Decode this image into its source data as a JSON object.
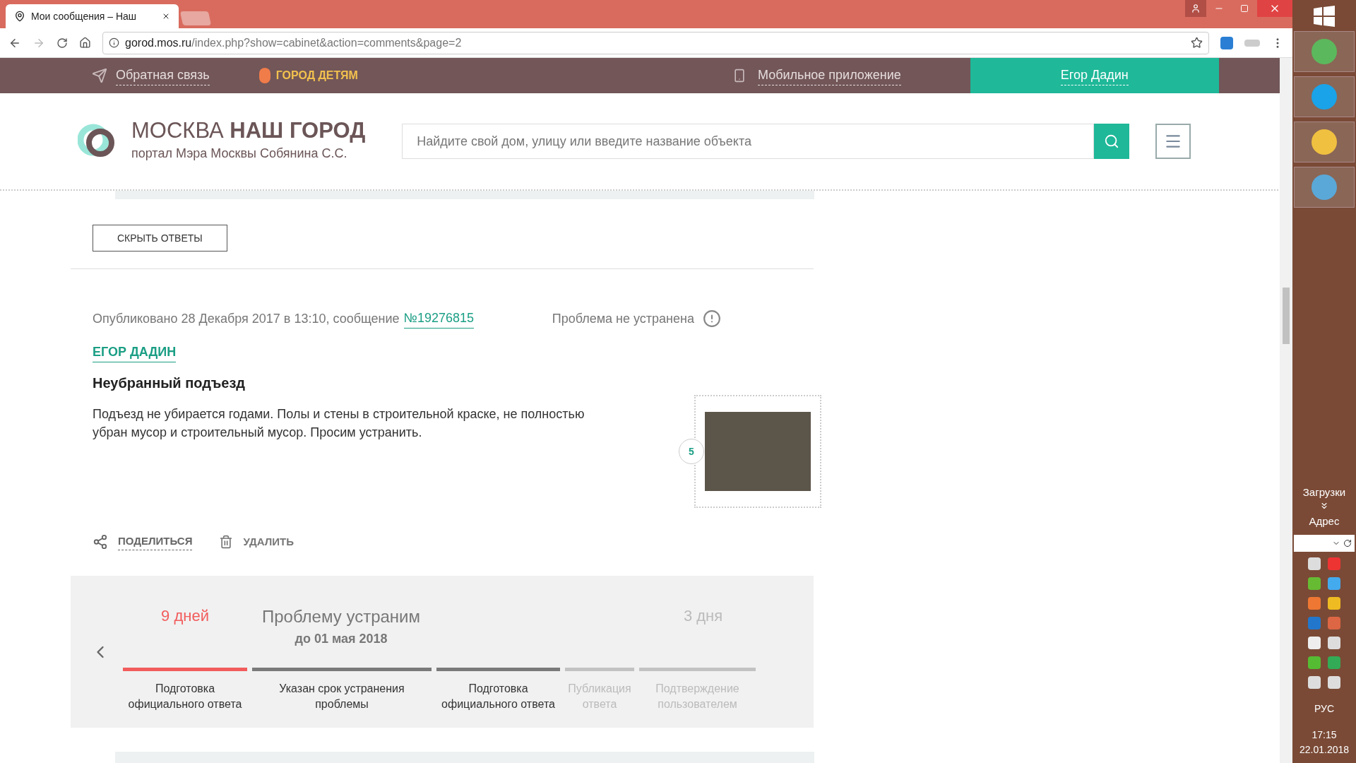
{
  "browser": {
    "tabs": [
      {
        "title": "Мои сообщения – Наш",
        "selected": true
      }
    ],
    "address": {
      "host": "gorod.mos.ru",
      "path": "/index.php?show=cabinet&action=comments&page=2"
    }
  },
  "site_nav": {
    "feedback": "Обратная связь",
    "kids": "ГОРОД ДЕТЯМ",
    "mobile": "Мобильное приложение",
    "user": "Егор Дадин"
  },
  "header": {
    "logo_light": "МОСКВА",
    "logo_bold": "НАШ ГОРОД",
    "logo_subtitle": "портал Мэра Москвы Собянина С.С.",
    "search": {
      "placeholder": "Найдите свой дом, улицу или введите название объекта"
    }
  },
  "hide_answers_button": "СКРЫТЬ ОТВЕТЫ",
  "comment": {
    "published": "Опубликовано 28 Декабря 2017 в 13:10, сообщение",
    "number": "№19276815",
    "status": "Проблема не устранена",
    "author": "ЕГОР ДАДИН",
    "title": "Неубранный подъезд",
    "text": "Подъезд не убирается годами. Полы и стены в строительной краске, не полностью убран мусор и строительный мусор. Просим устранить.",
    "photo_count": "5",
    "actions": {
      "share": "ПОДЕЛИТЬСЯ",
      "delete": "УДАЛИТЬ"
    }
  },
  "timeline": {
    "elapsed": "9 дней",
    "title": "Проблему устраним",
    "deadline": "до 01 мая 2018",
    "remaining": "3 дня",
    "stages": [
      {
        "label": "Подготовка официального ответа",
        "kind": "current"
      },
      {
        "label": "Указан срок устранения проблемы",
        "kind": "done"
      },
      {
        "label": "Подготовка официального ответа",
        "kind": "done"
      },
      {
        "label": "Публикация ответа",
        "kind": "pending"
      },
      {
        "label": "Подтверждение пользователем",
        "kind": "pending"
      }
    ]
  },
  "taskbar": {
    "downloads": "Загрузки",
    "address": "Адрес",
    "language": "РУС",
    "time": "17:15",
    "date": "22.01.2018"
  }
}
